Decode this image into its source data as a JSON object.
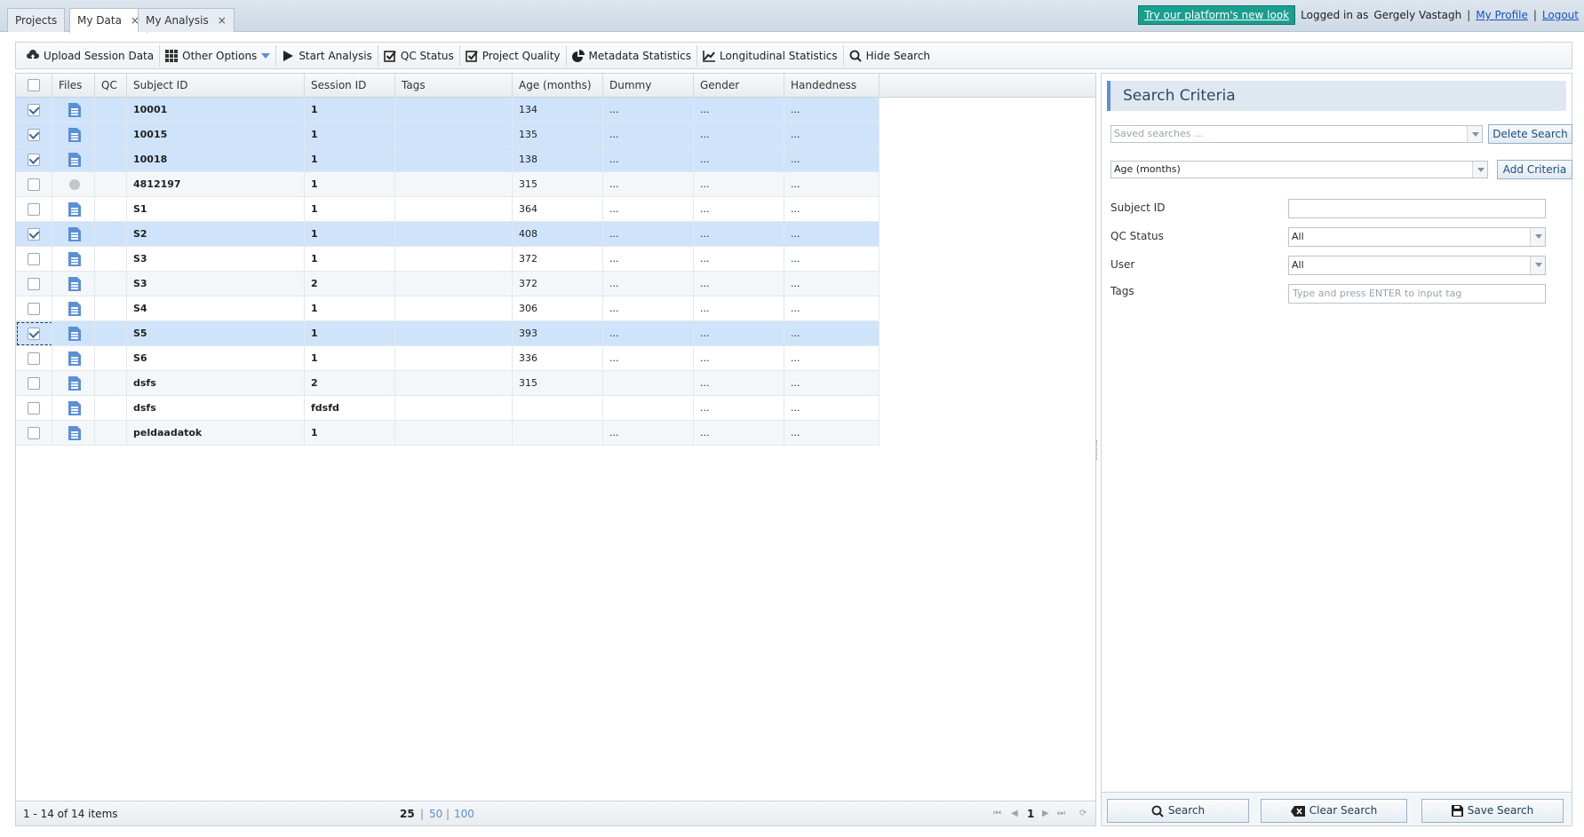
{
  "tabs": [
    {
      "label": "Projects",
      "closable": false,
      "active": false
    },
    {
      "label": "My Data",
      "closable": true,
      "active": true
    },
    {
      "label": "My Analysis",
      "closable": true,
      "active": false
    }
  ],
  "tab_close_glyph": "×",
  "header": {
    "new_look": "Try our platform's new look",
    "logged_in_as": "Logged in as",
    "user_name": "Gergely Vastagh",
    "separator": "|",
    "my_profile": "My Profile",
    "logout": "Logout"
  },
  "toolbar": {
    "upload": "Upload Session Data",
    "other_options": "Other Options",
    "start_analysis": "Start Analysis",
    "qc_status": "QC Status",
    "project_quality": "Project Quality",
    "metadata_statistics": "Metadata Statistics",
    "longitudinal_statistics": "Longitudinal Statistics",
    "hide_search": "Hide Search"
  },
  "grid": {
    "columns": [
      "Files",
      "QC",
      "Subject ID",
      "Session ID",
      "Tags",
      "Age (months)",
      "Dummy",
      "Gender",
      "Handedness"
    ],
    "rows": [
      {
        "checked": true,
        "file": "file",
        "subject": "10001",
        "session": "1",
        "tags": "",
        "age": "134",
        "dummy": "...",
        "gender": "...",
        "hand": "..."
      },
      {
        "checked": true,
        "file": "file",
        "subject": "10015",
        "session": "1",
        "tags": "",
        "age": "135",
        "dummy": "...",
        "gender": "...",
        "hand": "..."
      },
      {
        "checked": true,
        "file": "file",
        "subject": "10018",
        "session": "1",
        "tags": "",
        "age": "138",
        "dummy": "...",
        "gender": "...",
        "hand": "..."
      },
      {
        "checked": false,
        "file": "dot",
        "subject": "4812197",
        "session": "1",
        "tags": "",
        "age": "315",
        "dummy": "...",
        "gender": "...",
        "hand": "..."
      },
      {
        "checked": false,
        "file": "file",
        "subject": "S1",
        "session": "1",
        "tags": "",
        "age": "364",
        "dummy": "...",
        "gender": "...",
        "hand": "..."
      },
      {
        "checked": true,
        "file": "file",
        "subject": "S2",
        "session": "1",
        "tags": "",
        "age": "408",
        "dummy": "...",
        "gender": "...",
        "hand": "..."
      },
      {
        "checked": false,
        "file": "file",
        "subject": "S3",
        "session": "1",
        "tags": "",
        "age": "372",
        "dummy": "...",
        "gender": "...",
        "hand": "..."
      },
      {
        "checked": false,
        "file": "file",
        "subject": "S3",
        "session": "2",
        "tags": "",
        "age": "372",
        "dummy": "...",
        "gender": "...",
        "hand": "..."
      },
      {
        "checked": false,
        "file": "file",
        "subject": "S4",
        "session": "1",
        "tags": "",
        "age": "306",
        "dummy": "...",
        "gender": "...",
        "hand": "..."
      },
      {
        "checked": true,
        "file": "file",
        "subject": "S5",
        "session": "1",
        "tags": "",
        "age": "393",
        "dummy": "...",
        "gender": "...",
        "hand": "...",
        "focused": true
      },
      {
        "checked": false,
        "file": "file",
        "subject": "S6",
        "session": "1",
        "tags": "",
        "age": "336",
        "dummy": "...",
        "gender": "...",
        "hand": "..."
      },
      {
        "checked": false,
        "file": "file",
        "subject": "dsfs",
        "session": "2",
        "tags": "",
        "age": "315",
        "dummy": "",
        "gender": "...",
        "hand": "..."
      },
      {
        "checked": false,
        "file": "file",
        "subject": "dsfs",
        "session": "fdsfd",
        "tags": "",
        "age": "",
        "dummy": "",
        "gender": "...",
        "hand": "..."
      },
      {
        "checked": false,
        "file": "file",
        "subject": "peldaadatok",
        "session": "1",
        "tags": "",
        "age": "",
        "dummy": "...",
        "gender": "...",
        "hand": "..."
      }
    ],
    "footer": {
      "items_info": "1 - 14 of 14 items",
      "page_sizes": [
        "25",
        "50",
        "100"
      ],
      "page_size_sep": "|",
      "current_page": "1",
      "nav": {
        "first": "⏮",
        "prev": "◀",
        "next": "▶",
        "last": "⏭",
        "refresh": "⟳"
      }
    }
  },
  "search": {
    "title": "Search Criteria",
    "saved_searches_placeholder": "Saved searches ...",
    "delete_search": "Delete Search",
    "criteria_selected": "Age (months)",
    "add_criteria": "Add Criteria",
    "fields": {
      "subject_id_label": "Subject ID",
      "subject_id_value": "",
      "qc_status_label": "QC Status",
      "qc_status_value": "All",
      "user_label": "User",
      "user_value": "All",
      "tags_label": "Tags",
      "tags_placeholder": "Type and press ENTER to input tag"
    },
    "buttons": {
      "search": "Search",
      "clear": "Clear Search",
      "save": "Save Search"
    }
  },
  "colors": {
    "accent": "#5b8fd8",
    "selected_row": "#cfe4fb",
    "new_look_bg": "#1a9e8f"
  }
}
